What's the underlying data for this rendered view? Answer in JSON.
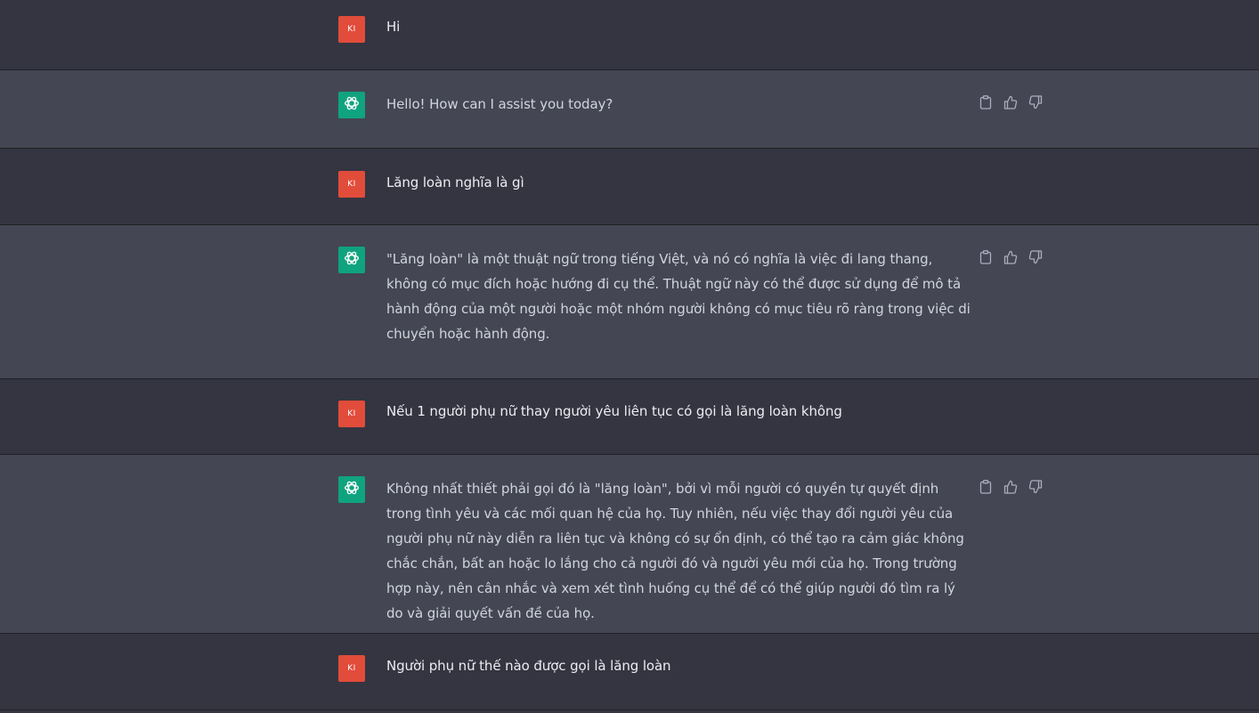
{
  "user": {
    "avatar_initials": "KI",
    "avatar_color": "#e24c3a"
  },
  "assistant": {
    "avatar_icon": "openai-logo-icon",
    "avatar_color": "#10a37f"
  },
  "colors": {
    "user_row_bg": "#343541",
    "assistant_row_bg": "#444654",
    "text": "#d1d5db",
    "icon": "#acacbe"
  },
  "actions": {
    "copy_icon": "clipboard-icon",
    "like_icon": "thumbs-up-icon",
    "dislike_icon": "thumbs-down-icon"
  },
  "messages": [
    {
      "role": "user",
      "text": "Hi"
    },
    {
      "role": "assistant",
      "text": "Hello! How can I assist you today?"
    },
    {
      "role": "user",
      "text": "Lăng loàn nghĩa là gì"
    },
    {
      "role": "assistant",
      "text": "\"Lăng loàn\" là một thuật ngữ trong tiếng Việt, và nó có nghĩa là việc đi lang thang, không có mục đích hoặc hướng đi cụ thể. Thuật ngữ này có thể được sử dụng để mô tả hành động của một người hoặc một nhóm người không có mục tiêu rõ ràng trong việc di chuyển hoặc hành động."
    },
    {
      "role": "user",
      "text": "Nếu 1 người phụ nữ thay người yêu liên tục có gọi là lăng loàn không"
    },
    {
      "role": "assistant",
      "text": "Không nhất thiết phải gọi đó là \"lăng loàn\", bởi vì mỗi người có quyền tự quyết định trong tình yêu và các mối quan hệ của họ. Tuy nhiên, nếu việc thay đổi người yêu của người phụ nữ này diễn ra liên tục và không có sự ổn định, có thể tạo ra cảm giác không chắc chắn, bất an hoặc lo lắng cho cả người đó và người yêu mới của họ. Trong trường hợp này, nên cân nhắc và xem xét tình huống cụ thể để có thể giúp người đó tìm ra lý do và giải quyết vấn đề của họ."
    },
    {
      "role": "user",
      "text": "Người phụ nữ thế nào được gọi là lăng loàn"
    }
  ]
}
